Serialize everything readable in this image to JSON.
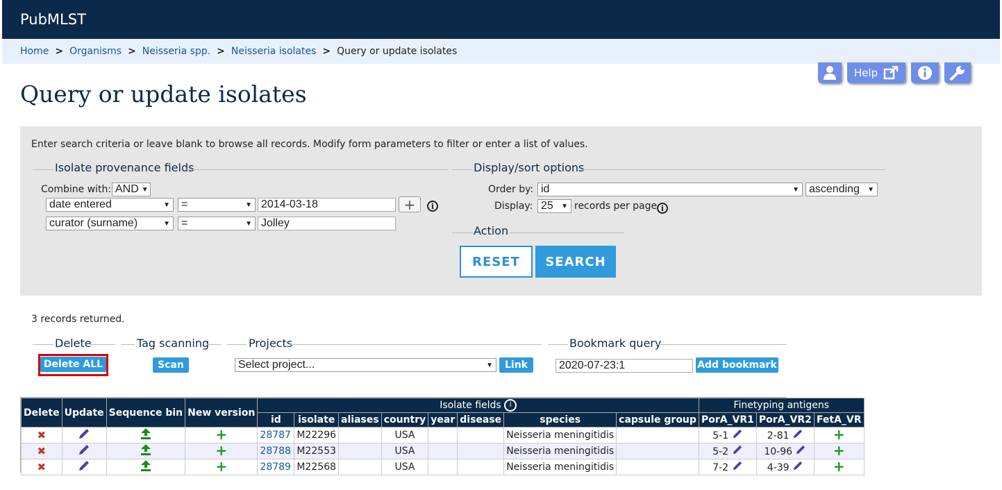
{
  "header": {
    "site_title": "PubMLST"
  },
  "breadcrumb": {
    "items": [
      "Home",
      "Organisms",
      "Neisseria spp.",
      "Neisseria isolates"
    ],
    "separator": ">",
    "current": "Query or update isolates"
  },
  "toolbar": {
    "help_label": "Help"
  },
  "page_title": "Query or update isolates",
  "form": {
    "intro": "Enter search criteria or leave blank to browse all records. Modify form parameters to filter or enter a list of values.",
    "provenance": {
      "legend": "Isolate provenance fields",
      "combine_label": "Combine with:",
      "combine_value": "AND",
      "rows": [
        {
          "field": "date entered",
          "operator": "=",
          "value": "2014-03-18"
        },
        {
          "field": "curator (surname)",
          "operator": "=",
          "value": "Jolley"
        }
      ]
    },
    "display": {
      "legend": "Display/sort options",
      "order_label": "Order by:",
      "order_value": "id",
      "direction_value": "ascending",
      "display_label": "Display:",
      "display_value": "25",
      "per_page_label": "records per page"
    },
    "action": {
      "legend": "Action",
      "reset_label": "RESET",
      "search_label": "SEARCH"
    }
  },
  "results": {
    "count_text": "3 records returned.",
    "delete": {
      "legend": "Delete",
      "button": "Delete ALL"
    },
    "tag_scanning": {
      "legend": "Tag scanning",
      "button": "Scan"
    },
    "projects": {
      "legend": "Projects",
      "select_value": "Select project...",
      "button": "Link"
    },
    "bookmark": {
      "legend": "Bookmark query",
      "input_value": "2020-07-23:1",
      "button": "Add bookmark"
    }
  },
  "table": {
    "group_headers": {
      "isolate_fields": "Isolate fields",
      "finetyping": "Finetyping antigens"
    },
    "headers": {
      "delete": "Delete",
      "update": "Update",
      "sequence_bin": "Sequence bin",
      "new_version": "New version",
      "id": "id",
      "isolate": "isolate",
      "aliases": "aliases",
      "country": "country",
      "year": "year",
      "disease": "disease",
      "species": "species",
      "capsule_group": "capsule group",
      "pora_vr1": "PorA_VR1",
      "pora_vr2": "PorA_VR2",
      "feta_vr": "FetA_VR"
    },
    "rows": [
      {
        "id": "28787",
        "isolate": "M22296",
        "aliases": "",
        "country": "USA",
        "year": "",
        "disease": "",
        "species": "Neisseria meningitidis",
        "capsule_group": "",
        "pora_vr1": "5-1",
        "pora_vr2": "2-81"
      },
      {
        "id": "28788",
        "isolate": "M22553",
        "aliases": "",
        "country": "USA",
        "year": "",
        "disease": "",
        "species": "Neisseria meningitidis",
        "capsule_group": "",
        "pora_vr1": "5-2",
        "pora_vr2": "10-96"
      },
      {
        "id": "28789",
        "isolate": "M22568",
        "aliases": "",
        "country": "USA",
        "year": "",
        "disease": "",
        "species": "Neisseria meningitidis",
        "capsule_group": "",
        "pora_vr1": "7-2",
        "pora_vr2": "4-39"
      }
    ]
  }
}
